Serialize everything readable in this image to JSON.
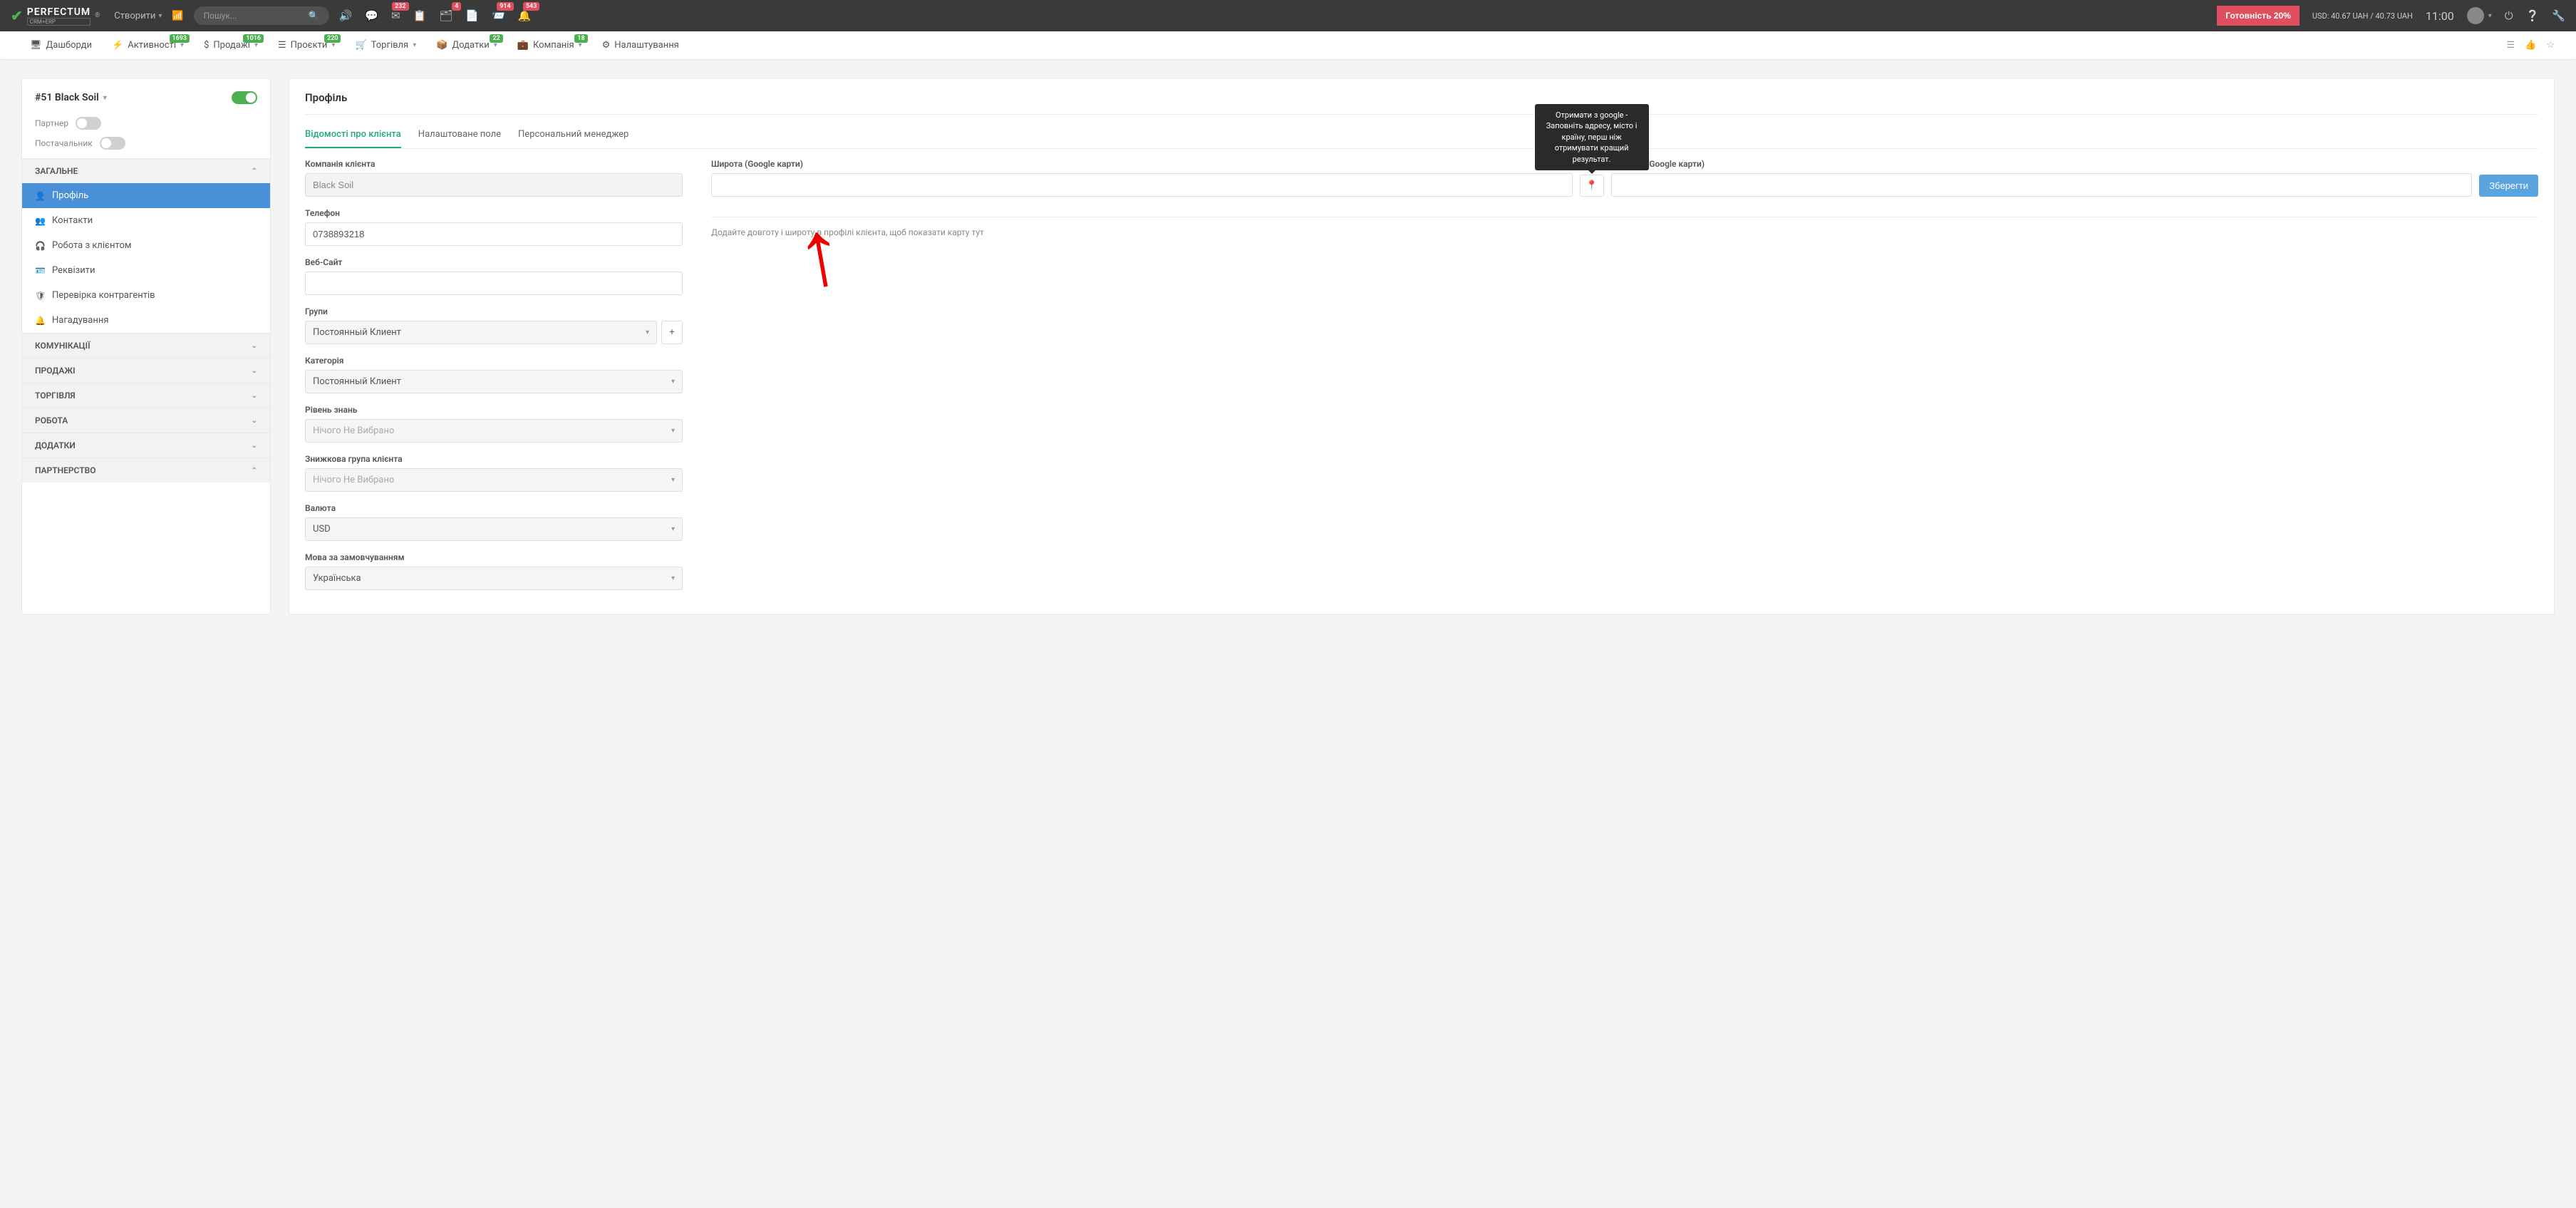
{
  "brand": {
    "name": "PERFECTUM",
    "sub": "CRM+ERP",
    "reg": "®"
  },
  "topbar": {
    "create": "Створити",
    "search_placeholder": "Пошук...",
    "badges": {
      "mail": "232",
      "tasks": "4",
      "notif": "914",
      "bell": "543"
    },
    "ready": "Готовність 20%",
    "rate": "USD: 40.67 UAH / 40.73 UAH",
    "clock": "11:00"
  },
  "nav": {
    "items": [
      {
        "label": "Дашборди"
      },
      {
        "label": "Активності",
        "badge": "1693"
      },
      {
        "label": "Продажі",
        "badge": "1016"
      },
      {
        "label": "Проєкти",
        "badge": "220"
      },
      {
        "label": "Торгівля"
      },
      {
        "label": "Додатки",
        "badge": "22"
      },
      {
        "label": "Компанія",
        "badge": "18"
      },
      {
        "label": "Налаштування"
      }
    ]
  },
  "sidebar": {
    "title": "#51 Black Soil",
    "partner_label": "Партнер",
    "supplier_label": "Постачальник",
    "sec_general": "ЗАГАЛЬНЕ",
    "menu": {
      "profile": "Профіль",
      "contacts": "Контакти",
      "work": "Робота з клієнтом",
      "requisites": "Реквізити",
      "counterparty": "Перевірка контрагентів",
      "reminders": "Нагадування"
    },
    "sec_comm": "КОМУНІКАЦІЇ",
    "sec_sales": "ПРОДАЖІ",
    "sec_trade": "ТОРГІВЛЯ",
    "sec_work": "РОБОТА",
    "sec_addons": "ДОДАТКИ",
    "sec_partner": "ПАРТНЕРСТВО"
  },
  "main": {
    "title": "Профіль",
    "tabs": {
      "info": "Відомості про клієнта",
      "custom": "Налаштоване поле",
      "manager": "Персональний менеджер"
    },
    "labels": {
      "company": "Компанія клієнта",
      "phone": "Телефон",
      "website": "Веб-Сайт",
      "groups": "Групи",
      "category": "Категорія",
      "knowledge": "Рівень знань",
      "discount": "Знижкова група клієнта",
      "currency": "Валюта",
      "lang": "Мова за замовчуванням",
      "lat": "Широта (Google карти)",
      "lon": "Довгота (Google карти)"
    },
    "values": {
      "company": "Black Soil",
      "phone": "0738893218",
      "website": "",
      "groups": "Постоянный Клиент",
      "category": "Постоянный Клиент",
      "knowledge": "Нічого Не Вибрано",
      "discount": "Нічого Не Вибрано",
      "currency": "USD",
      "lang": "Українська"
    },
    "save": "Зберегти",
    "map_hint": "Додайте довготу і широту в профілі клієнта, щоб показати карту тут",
    "tooltip": "Отримати з google - Заповніть адресу, місто і країну, перш ніж отримувати кращий результат."
  }
}
